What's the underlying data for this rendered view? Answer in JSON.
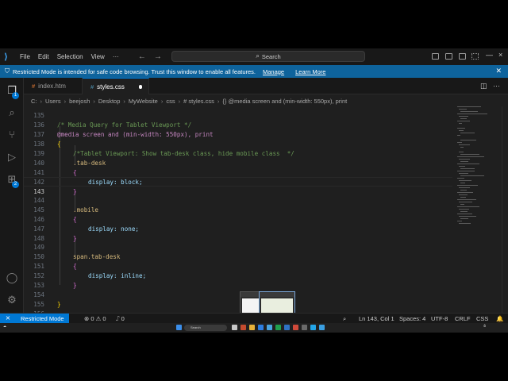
{
  "titlebar": {
    "menu": [
      "File",
      "Edit",
      "Selection",
      "View",
      "···"
    ],
    "search_label": "Search",
    "window_controls": [
      "minimize-icon",
      "maximize-icon",
      "close-icon"
    ]
  },
  "banner": {
    "message": "Restricted Mode is intended for safe code browsing. Trust this window to enable all features.",
    "manage": "Manage",
    "learn_more": "Learn More"
  },
  "activity": {
    "badge_explorer": "1",
    "badge_extensions": "2"
  },
  "tabs": [
    {
      "label": "index.htm",
      "icon": "#"
    },
    {
      "label": "styles.css",
      "icon": "#"
    }
  ],
  "breadcrumb": [
    "C:",
    "Users",
    "beejosh",
    "Desktop",
    "MyWebsite",
    "css",
    "# styles.css",
    "{} @media screen and (min-width: 550px), print"
  ],
  "editor": {
    "lines": [
      {
        "n": "135",
        "t": "/* Media Query for Tablet Viewport */"
      },
      {
        "n": "136",
        "t": "@media screen and (min-width: 550px), print"
      },
      {
        "n": "137",
        "t": "{"
      },
      {
        "n": "138",
        "t": "/*Tablet Viewport: Show tab-desk class, hide mobile class  */"
      },
      {
        "n": "139",
        "t": ".tab-desk"
      },
      {
        "n": "140",
        "t": "{"
      },
      {
        "n": "141",
        "t": "display: block;"
      },
      {
        "n": "142",
        "t": "}"
      },
      {
        "n": "143",
        "t": ""
      },
      {
        "n": "144",
        "t": ".mobile"
      },
      {
        "n": "145",
        "t": "{"
      },
      {
        "n": "146",
        "t": "display: none;"
      },
      {
        "n": "147",
        "t": "}"
      },
      {
        "n": "148",
        "t": ""
      },
      {
        "n": "149",
        "t": "span.tab-desk"
      },
      {
        "n": "150",
        "t": "{"
      },
      {
        "n": "151",
        "t": "display: inline;"
      },
      {
        "n": "152",
        "t": "}"
      },
      {
        "n": "153",
        "t": ""
      },
      {
        "n": "154",
        "t": "}"
      },
      {
        "n": "155",
        "t": ""
      },
      {
        "n": "156",
        "t": ""
      }
    ]
  },
  "statusbar": {
    "restricted": "Restricted Mode",
    "problems": "⊗ 0 ⚠ 0",
    "ports": "⑀ 0",
    "position": "Ln 143, Col 1",
    "spaces": "Spaces: 4",
    "encoding": "UTF-8",
    "eol": "CRLF",
    "language": "CSS"
  },
  "taskbar": {
    "search": "Search"
  },
  "colors": {
    "accent": "#0078d4",
    "banner": "#0e639c",
    "editor_bg": "#1f1f1f",
    "comment": "#6a9955",
    "property": "#9cdcfe",
    "selector": "#d7ba7d"
  }
}
